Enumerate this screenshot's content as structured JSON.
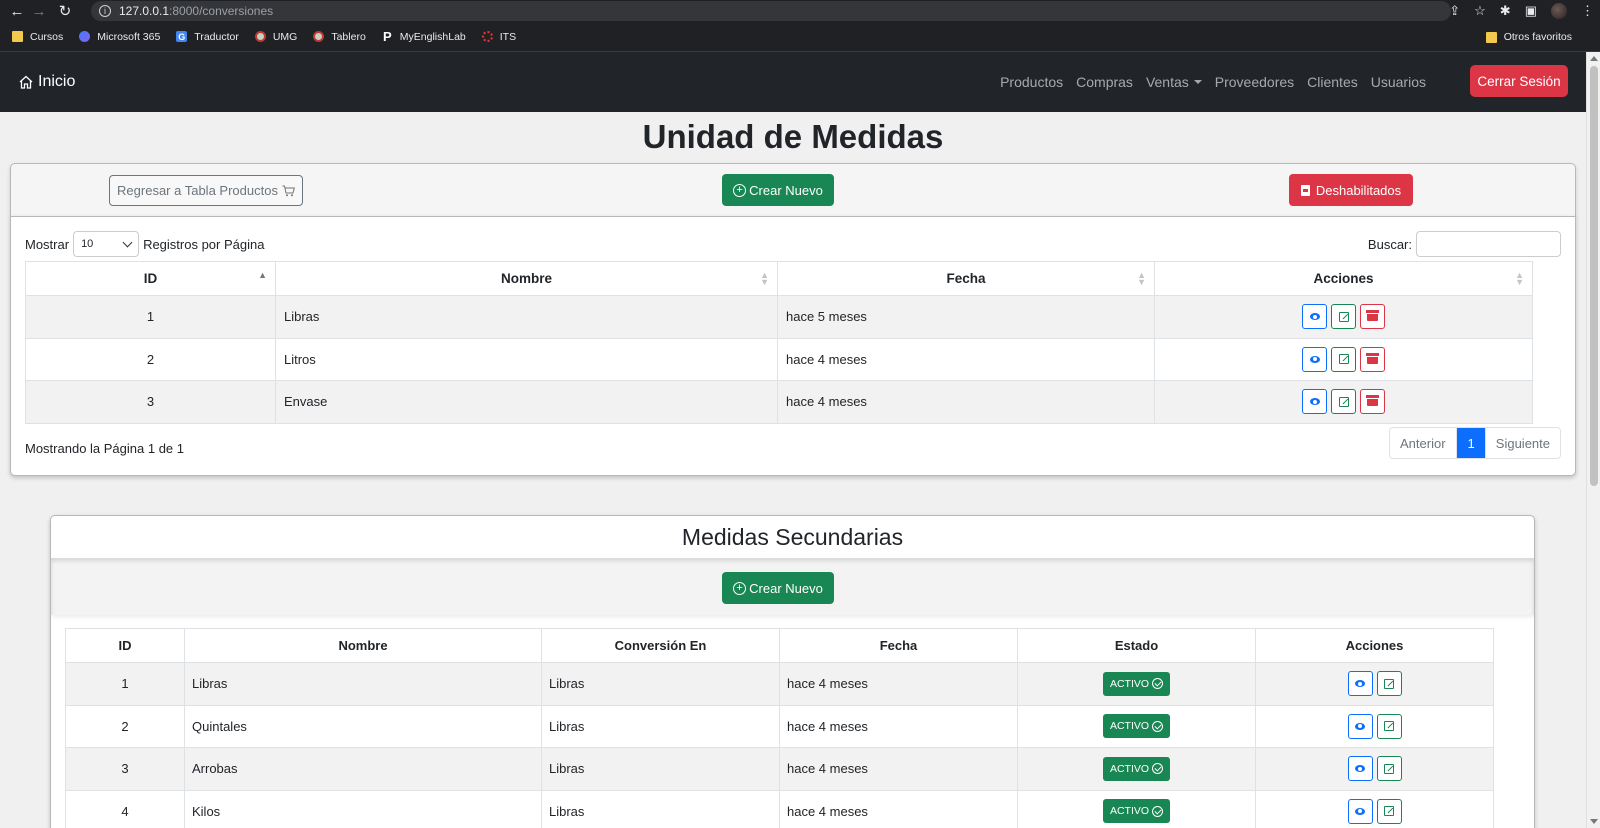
{
  "browser": {
    "url_host": "127.0.0.1",
    "url_path": ":8000/conversiones",
    "bookmarks": [
      "Cursos",
      "Microsoft 365",
      "Traductor",
      "UMG",
      "Tablero",
      "MyEnglishLab",
      "ITS"
    ],
    "other_bookmarks": "Otros favoritos"
  },
  "navbar": {
    "brand": "Inicio",
    "links": [
      "Productos",
      "Compras",
      "Ventas",
      "Proveedores",
      "Clientes",
      "Usuarios"
    ],
    "logout": "Cerrar Sesión"
  },
  "main": {
    "title": "Unidad de Medidas",
    "back_button": "Regresar a Tabla Productos",
    "create_button": "Crear Nuevo",
    "disabled_button": "Deshabilitados",
    "show_label": "Mostrar",
    "page_size": "10",
    "per_page_label": "Registros por Página",
    "search_label": "Buscar:",
    "columns": [
      "ID",
      "Nombre",
      "Fecha",
      "Acciones"
    ],
    "rows": [
      {
        "id": "1",
        "nombre": "Libras",
        "fecha": "hace 5 meses"
      },
      {
        "id": "2",
        "nombre": "Litros",
        "fecha": "hace 4 meses"
      },
      {
        "id": "3",
        "nombre": "Envase",
        "fecha": "hace 4 meses"
      }
    ],
    "page_info": "Mostrando la Página 1 de 1",
    "pagination": {
      "prev": "Anterior",
      "current": "1",
      "next": "Siguiente"
    }
  },
  "secondary": {
    "title": "Medidas Secundarias",
    "create_button": "Crear Nuevo",
    "columns": [
      "ID",
      "Nombre",
      "Conversión En",
      "Fecha",
      "Estado",
      "Acciones"
    ],
    "rows": [
      {
        "id": "1",
        "nombre": "Libras",
        "conversion": "Libras",
        "fecha": "hace 4 meses",
        "estado": "ACTIVO"
      },
      {
        "id": "2",
        "nombre": "Quintales",
        "conversion": "Libras",
        "fecha": "hace 4 meses",
        "estado": "ACTIVO"
      },
      {
        "id": "3",
        "nombre": "Arrobas",
        "conversion": "Libras",
        "fecha": "hace 4 meses",
        "estado": "ACTIVO"
      },
      {
        "id": "4",
        "nombre": "Kilos",
        "conversion": "Libras",
        "fecha": "hace 4 meses",
        "estado": "ACTIVO"
      }
    ]
  },
  "colors": {
    "primary": "#0d6efd",
    "success": "#198754",
    "danger": "#dc3545",
    "dark": "#212529"
  }
}
